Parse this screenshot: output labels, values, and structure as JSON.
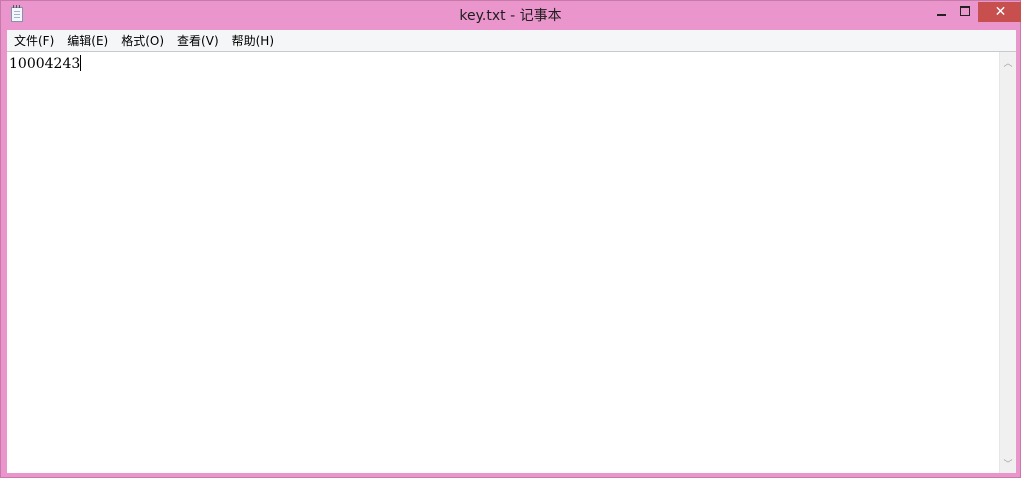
{
  "window": {
    "title": "key.txt - 记事本",
    "controls": {
      "minimize_icon": "minimize-icon",
      "maximize_icon": "maximize-icon",
      "close_label": "✕"
    },
    "colors": {
      "frame": "#ea95cc",
      "close": "#c7504f"
    }
  },
  "menu": {
    "items": [
      "文件(F)",
      "编辑(E)",
      "格式(O)",
      "查看(V)",
      "帮助(H)"
    ]
  },
  "editor": {
    "content": "10004243"
  },
  "scrollbar": {
    "up_arrow": "︿",
    "down_arrow": "﹀"
  }
}
